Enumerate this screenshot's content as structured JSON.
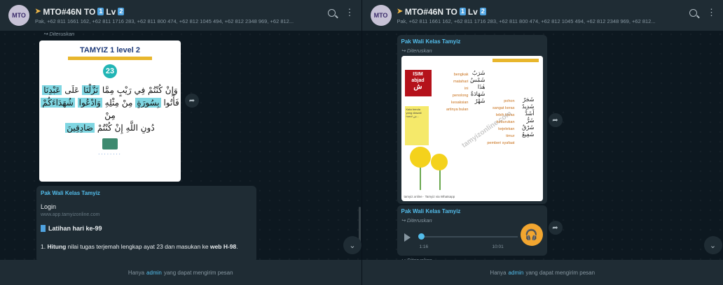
{
  "group": {
    "avatar_text": "MTO",
    "title": "MTO#46N TO",
    "title_badge1": "1",
    "title_lv": "Lv",
    "title_badge2": "2",
    "subtitle_left": "Pak, +62 811 1661 162, +62 811 1716 283, +62 811 800 474, +62 812 1045 494, +62 812 2348 969, +62 812...",
    "subtitle_right": "Pak, +62 811 1661 162, +62 811 1716 283, +62 811 800 474, +62 812 1045 494, +62 812 2348 969, +62 812..."
  },
  "icons": {
    "search": "search-icon",
    "menu": "more-vertical-icon",
    "share": "forward-share-icon",
    "scroll": "chevron-down-icon",
    "headset": "headphones-icon"
  },
  "left": {
    "forwarded_top": "Diteruskan",
    "image": {
      "title": "TAMYIZ 1 level 2",
      "number": "23",
      "line1a": "وَإِنْ كُنْتُمْ فِي رَيْبٍ مِمَّا",
      "line1b": "نَزَّلْنَا",
      "line1c": "عَلَى",
      "line1d": "عَبْدِنَا",
      "line2a": "فَأْتُوا",
      "line2b": "بِسُورَةٍ",
      "line2c": "مِنْ مِثْلِهِ",
      "line2d": "وَادْعُوا",
      "line2e": "شُهَدَاءَكُمْ",
      "line2f": "مِنْ",
      "line3a": "دُونِ اللَّهِ إِنْ كُنْتُمْ",
      "line3b": "صَادِقِينَ",
      "dots": "........"
    },
    "message": {
      "sender": "Pak Wali Kelas Tamyiz",
      "link_title": "Login",
      "link_url": "www.app.tamyizonline.com",
      "heading": "Latihan hari ke-99",
      "body_prefix": "1. ",
      "body_bold1": "Hitung",
      "body_mid": " nilai tugas terjemah lengkap ayat 23 dan masukan ke ",
      "body_bold2": "web H-98",
      "body_end": "."
    }
  },
  "right": {
    "sender1": "Pak Wali Kelas Tamyiz",
    "forwarded1": "Diteruskan",
    "image": {
      "isim": "ISIM",
      "abjad": "abjad",
      "isim_ar": "ش",
      "yellow_text": "Kata benda yang diawali huruf ش...",
      "left_words": [
        "bengkak",
        "matahari",
        "ini",
        "penolong",
        "kesaksian",
        "artinya bulan"
      ],
      "left_ar": [
        "شَرَبٌ",
        "شَمْسٌ",
        "هٰذَا",
        "شَهَادَةٌ",
        "شَهْرٌ"
      ],
      "right_words": [
        "pohon",
        "sangat keras",
        "lebih keras",
        "keburukan",
        "kejelekan",
        "timur",
        "pemberi syafaat"
      ],
      "right_ar": [
        "شَجَرٌ",
        "شَدِيدٌ",
        "أَشَدُّ",
        "شَرٌّ",
        "شَرْقٌ",
        "شَفِيعٌ"
      ],
      "watermark": "tamyizonline.com",
      "footer": "tamyiz.online · Tamyiz via Whatsapp"
    },
    "sender2": "Pak Wali Kelas Tamyiz",
    "forwarded2": "Diteruskan",
    "audio": {
      "elapsed": "1:16",
      "duration": "10:01"
    },
    "forwarded3": "Diteruskan"
  },
  "footer": {
    "prefix": "Hanya",
    "admin": "admin",
    "suffix": "yang dapat mengirim pesan"
  },
  "colors": {
    "accent": "#53bdeb",
    "header": "#1f2c34",
    "bg": "#0d1820",
    "audio_btn": "#f2a630"
  }
}
